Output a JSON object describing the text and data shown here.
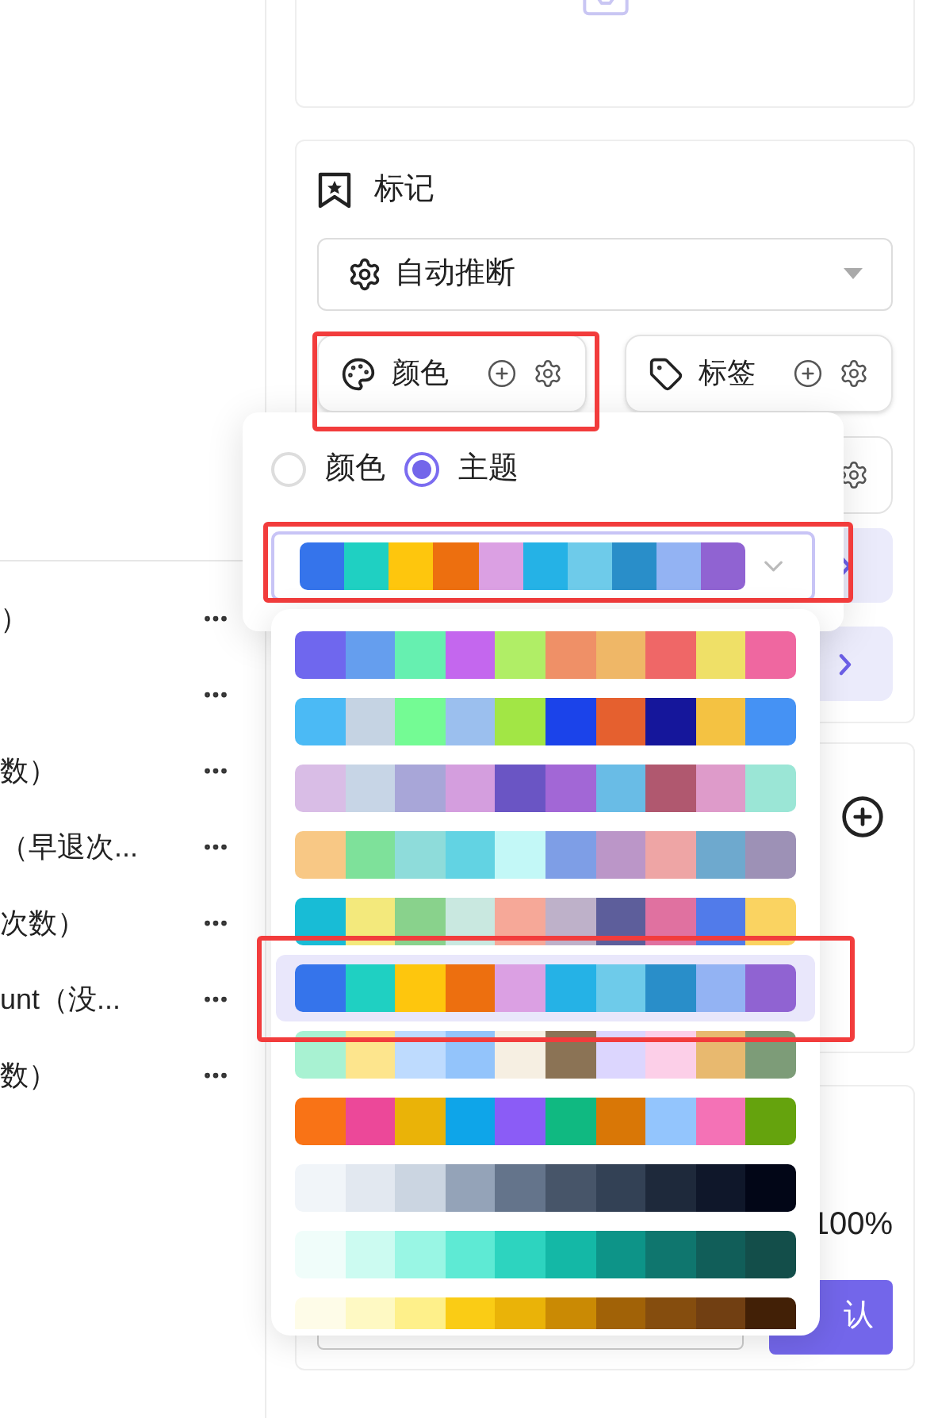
{
  "left_list": {
    "rows": [
      {
        "label": "）"
      },
      {},
      {
        "label": "数）"
      },
      {
        "label": "（早退次..."
      },
      {
        "label": "次数）"
      },
      {
        "label": "unt（没..."
      },
      {
        "label": "数）"
      }
    ]
  },
  "mark_panel": {
    "title": "标记",
    "mode_select": {
      "value": "自动推断"
    },
    "buttons": [
      {
        "label": "颜色",
        "highlighted": true
      },
      {
        "label": "标签",
        "highlighted": false
      }
    ]
  },
  "popover": {
    "radios": [
      {
        "label": "颜色",
        "selected": false
      },
      {
        "label": "主题",
        "selected": true
      }
    ],
    "theme_select": {
      "highlighted": true,
      "colors": [
        {
          "color": "#3574eb"
        },
        {
          "color": "#1fd0c2"
        },
        {
          "color": "#fec60d"
        },
        {
          "color": "#ed6f0f"
        },
        {
          "color": "#dba0e3"
        },
        {
          "color": "#25b2e6"
        },
        {
          "color": "#6ecbea"
        },
        {
          "color": "#298ec9"
        },
        {
          "color": "#93b3f3"
        },
        {
          "color": "#9063d2"
        }
      ]
    }
  },
  "theme_list": [
    {
      "selected": false,
      "highlighted": false,
      "colors": [
        {
          "color": "#6f67ee"
        },
        {
          "color": "#659eee"
        },
        {
          "color": "#66f0b0"
        },
        {
          "color": "#c467ee"
        },
        {
          "color": "#b0ee66"
        },
        {
          "color": "#ef9067"
        },
        {
          "color": "#efb767"
        },
        {
          "color": "#ef6767"
        },
        {
          "color": "#efe067"
        },
        {
          "color": "#ef67a0"
        }
      ]
    },
    {
      "selected": false,
      "highlighted": false,
      "colors": [
        {
          "color": "#4bbaf5"
        },
        {
          "color": "#c5d3e3"
        },
        {
          "color": "#74fb94"
        },
        {
          "color": "#9bbfee"
        },
        {
          "color": "#a2e645"
        },
        {
          "color": "#1b43ea"
        },
        {
          "color": "#e5602f"
        },
        {
          "color": "#15169b"
        },
        {
          "color": "#f4c242"
        },
        {
          "color": "#4592f4"
        }
      ]
    },
    {
      "selected": false,
      "highlighted": false,
      "colors": [
        {
          "color": "#d9bde6"
        },
        {
          "color": "#c7d5e6"
        },
        {
          "color": "#a8a6d8"
        },
        {
          "color": "#d49ede"
        },
        {
          "color": "#6a55c4"
        },
        {
          "color": "#a267d6"
        },
        {
          "color": "#69bce6"
        },
        {
          "color": "#b0586f"
        },
        {
          "color": "#de9bca"
        },
        {
          "color": "#9be6d6"
        }
      ]
    },
    {
      "selected": false,
      "highlighted": false,
      "colors": [
        {
          "color": "#f8c885"
        },
        {
          "color": "#7ee19a"
        },
        {
          "color": "#8edcda"
        },
        {
          "color": "#62d3e3"
        },
        {
          "color": "#c3f8f7"
        },
        {
          "color": "#7e9ee6"
        },
        {
          "color": "#bb96c8"
        },
        {
          "color": "#eea5a5"
        },
        {
          "color": "#6ea9ce"
        },
        {
          "color": "#9d91b6"
        }
      ]
    },
    {
      "selected": false,
      "highlighted": false,
      "colors": [
        {
          "color": "#18bcd6"
        },
        {
          "color": "#f3e97c"
        },
        {
          "color": "#89d28c"
        },
        {
          "color": "#c9e8e0"
        },
        {
          "color": "#f6a898"
        },
        {
          "color": "#beb1c9"
        },
        {
          "color": "#5d5e9b"
        },
        {
          "color": "#e071a0"
        },
        {
          "color": "#517bea"
        },
        {
          "color": "#fad361"
        }
      ]
    },
    {
      "selected": true,
      "highlighted": true,
      "colors": [
        {
          "color": "#3574eb"
        },
        {
          "color": "#1fd0c2"
        },
        {
          "color": "#fec60d"
        },
        {
          "color": "#ed6f0f"
        },
        {
          "color": "#dba0e3"
        },
        {
          "color": "#25b2e6"
        },
        {
          "color": "#6ecbea"
        },
        {
          "color": "#298ec9"
        },
        {
          "color": "#93b3f3"
        },
        {
          "color": "#9063d2"
        }
      ]
    },
    {
      "selected": false,
      "highlighted": false,
      "colors": [
        {
          "color": "#a8f2d2"
        },
        {
          "color": "#fde58d"
        },
        {
          "color": "#bedbfe"
        },
        {
          "color": "#93c4fb"
        },
        {
          "color": "#f6efe2"
        },
        {
          "color": "#8b7355"
        },
        {
          "color": "#dcd6fe"
        },
        {
          "color": "#fccfe8"
        },
        {
          "color": "#e8b96f"
        },
        {
          "color": "#7d9c78"
        }
      ]
    },
    {
      "selected": false,
      "highlighted": false,
      "colors": [
        {
          "color": "#f97316"
        },
        {
          "color": "#ec4899"
        },
        {
          "color": "#eab308"
        },
        {
          "color": "#0ea5e9"
        },
        {
          "color": "#8b5cf6"
        },
        {
          "color": "#10b981"
        },
        {
          "color": "#d97706"
        },
        {
          "color": "#93c5fd"
        },
        {
          "color": "#f472b6"
        },
        {
          "color": "#65a30d"
        }
      ]
    },
    {
      "selected": false,
      "highlighted": false,
      "colors": [
        {
          "color": "#f1f5f9"
        },
        {
          "color": "#e2e8f0"
        },
        {
          "color": "#cbd5e1"
        },
        {
          "color": "#94a3b8"
        },
        {
          "color": "#64748b"
        },
        {
          "color": "#475569"
        },
        {
          "color": "#334155"
        },
        {
          "color": "#1e293b"
        },
        {
          "color": "#0f172a"
        },
        {
          "color": "#020617"
        }
      ]
    },
    {
      "selected": false,
      "highlighted": false,
      "colors": [
        {
          "color": "#f0fdfa"
        },
        {
          "color": "#ccfbf1"
        },
        {
          "color": "#99f6e4"
        },
        {
          "color": "#5eead4"
        },
        {
          "color": "#2dd4bf"
        },
        {
          "color": "#14b8a6"
        },
        {
          "color": "#0d9488"
        },
        {
          "color": "#0f766e"
        },
        {
          "color": "#115e59"
        },
        {
          "color": "#134e4a"
        }
      ]
    },
    {
      "selected": false,
      "highlighted": false,
      "colors": [
        {
          "color": "#fefce8"
        },
        {
          "color": "#fef9c3"
        },
        {
          "color": "#fef08a"
        },
        {
          "color": "#facc15"
        },
        {
          "color": "#eab308"
        },
        {
          "color": "#ca8a04"
        },
        {
          "color": "#a16207"
        },
        {
          "color": "#854d0e"
        },
        {
          "color": "#713f12"
        },
        {
          "color": "#422006"
        }
      ]
    }
  ],
  "bottom_panel": {
    "percent": "100%",
    "confirm_button": "认"
  }
}
